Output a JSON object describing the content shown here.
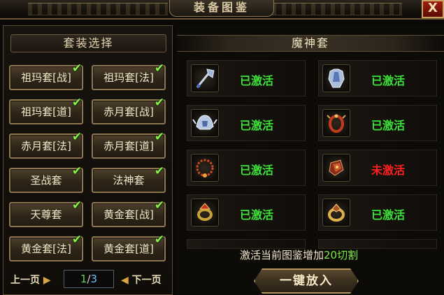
{
  "window": {
    "title": "装备图鉴",
    "close_label": "X"
  },
  "left": {
    "header": "套装选择",
    "suits": [
      {
        "label": "祖玛套[战]",
        "checked": true
      },
      {
        "label": "祖玛套[法]",
        "checked": true
      },
      {
        "label": "祖玛套[道]",
        "checked": true
      },
      {
        "label": "赤月套[战]",
        "checked": true
      },
      {
        "label": "赤月套[法]",
        "checked": true
      },
      {
        "label": "赤月套[道]",
        "checked": true
      },
      {
        "label": "圣战套",
        "checked": true
      },
      {
        "label": "法神套",
        "checked": true
      },
      {
        "label": "天尊套",
        "checked": true
      },
      {
        "label": "黄金套[战]",
        "checked": true
      },
      {
        "label": "黄金套[法]",
        "checked": true
      },
      {
        "label": "黄金套[道]",
        "checked": true
      }
    ],
    "pager": {
      "prev_label": "上一页",
      "next_label": "下一页",
      "current": "1",
      "separator": "/",
      "total": "3"
    }
  },
  "right": {
    "header": "魔神套",
    "items": [
      {
        "icon": "axe-weapon-icon",
        "status": "已激活",
        "active": true
      },
      {
        "icon": "armor-icon",
        "status": "已激活",
        "active": true
      },
      {
        "icon": "helmet-icon",
        "status": "已激活",
        "active": true
      },
      {
        "icon": "bracelet-icon",
        "status": "已激活",
        "active": true
      },
      {
        "icon": "necklace-icon",
        "status": "已激活",
        "active": true
      },
      {
        "icon": "bracer-icon",
        "status": "未激活",
        "active": false
      },
      {
        "icon": "ring-icon",
        "status": "已激活",
        "active": true
      },
      {
        "icon": "ring-gold-icon",
        "status": "已激活",
        "active": true
      }
    ],
    "bonus": {
      "prefix": "激活当前图鉴增加",
      "value": "20切割"
    },
    "put_all_label": "一键放入"
  },
  "colors": {
    "active": "#39e337",
    "inactive": "#ff1f1f",
    "checkmark": "#8df04a",
    "frame_gold": "#8d7650"
  }
}
